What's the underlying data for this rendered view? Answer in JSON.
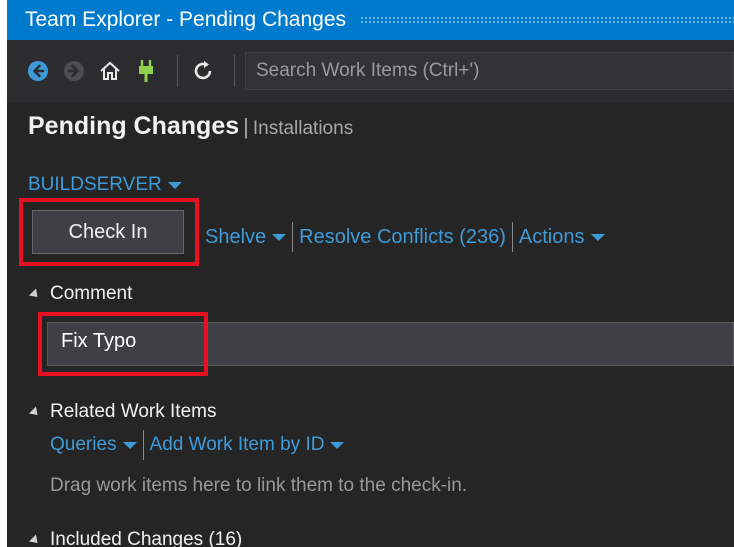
{
  "window": {
    "title": "Team Explorer - Pending Changes"
  },
  "toolbar": {
    "back_icon": "back-arrow-icon",
    "forward_icon": "forward-arrow-icon",
    "home_icon": "home-icon",
    "connect_icon": "plug-icon",
    "refresh_icon": "refresh-icon",
    "search_placeholder": "Search Work Items (Ctrl+')"
  },
  "header": {
    "title": "Pending Changes",
    "separator": "|",
    "subtitle": "Installations"
  },
  "server": {
    "label": "BUILDSERVER"
  },
  "actions": {
    "check_in": "Check In",
    "shelve": "Shelve",
    "resolve_conflicts": "Resolve Conflicts (236)",
    "actions_menu": "Actions"
  },
  "comment": {
    "header": "Comment",
    "value": "Fix Typo"
  },
  "related": {
    "header": "Related Work Items",
    "queries": "Queries",
    "add_by_id": "Add Work Item by ID",
    "hint": "Drag work items here to link them to the check-in."
  },
  "included": {
    "header": "Included Changes (16)"
  },
  "colors": {
    "accent": "#007acc",
    "link": "#3e9bd8",
    "highlight": "#e81123",
    "background": "#252526"
  }
}
